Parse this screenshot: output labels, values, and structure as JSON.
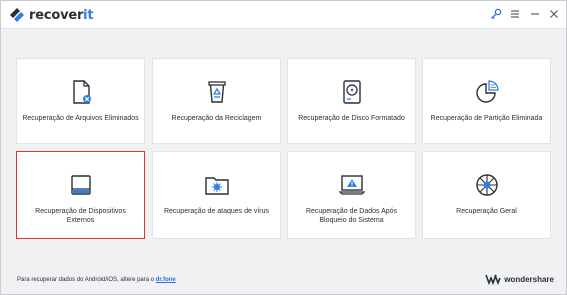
{
  "app": {
    "logo_text_a": "recover",
    "logo_text_b": "it"
  },
  "titlebar": {
    "icons": [
      "key-icon",
      "menu-icon",
      "minimize-icon",
      "close-icon"
    ]
  },
  "cards": [
    {
      "label": "Recuperação de Arquivos Eliminados",
      "icon": "deleted-file-icon"
    },
    {
      "label": "Recuperação da Reciclagem",
      "icon": "recycle-bin-icon"
    },
    {
      "label": "Recuperação de Disco Formatado",
      "icon": "formatted-disk-icon"
    },
    {
      "label": "Recuperação de Partição Eliminada",
      "icon": "partition-pie-icon"
    },
    {
      "label": "Recuperação de Dispositivos Externos",
      "icon": "external-drive-icon",
      "selected": true
    },
    {
      "label": "Recuperação de ataques de vírus",
      "icon": "virus-folder-icon"
    },
    {
      "label": "Recuperação de Dados Após Bloqueio do Sistema",
      "icon": "system-crash-icon"
    },
    {
      "label": "Recuperação Geral",
      "icon": "all-around-recovery-icon"
    }
  ],
  "footer": {
    "text": "Para recuperar dados do Android/iOS, altere para o",
    "link": "dr.fone",
    "brand": "wondershare"
  },
  "colors": {
    "accent_blue": "#2f7ee6",
    "selected_border": "#e0302f",
    "background": "#f0f1f3"
  }
}
